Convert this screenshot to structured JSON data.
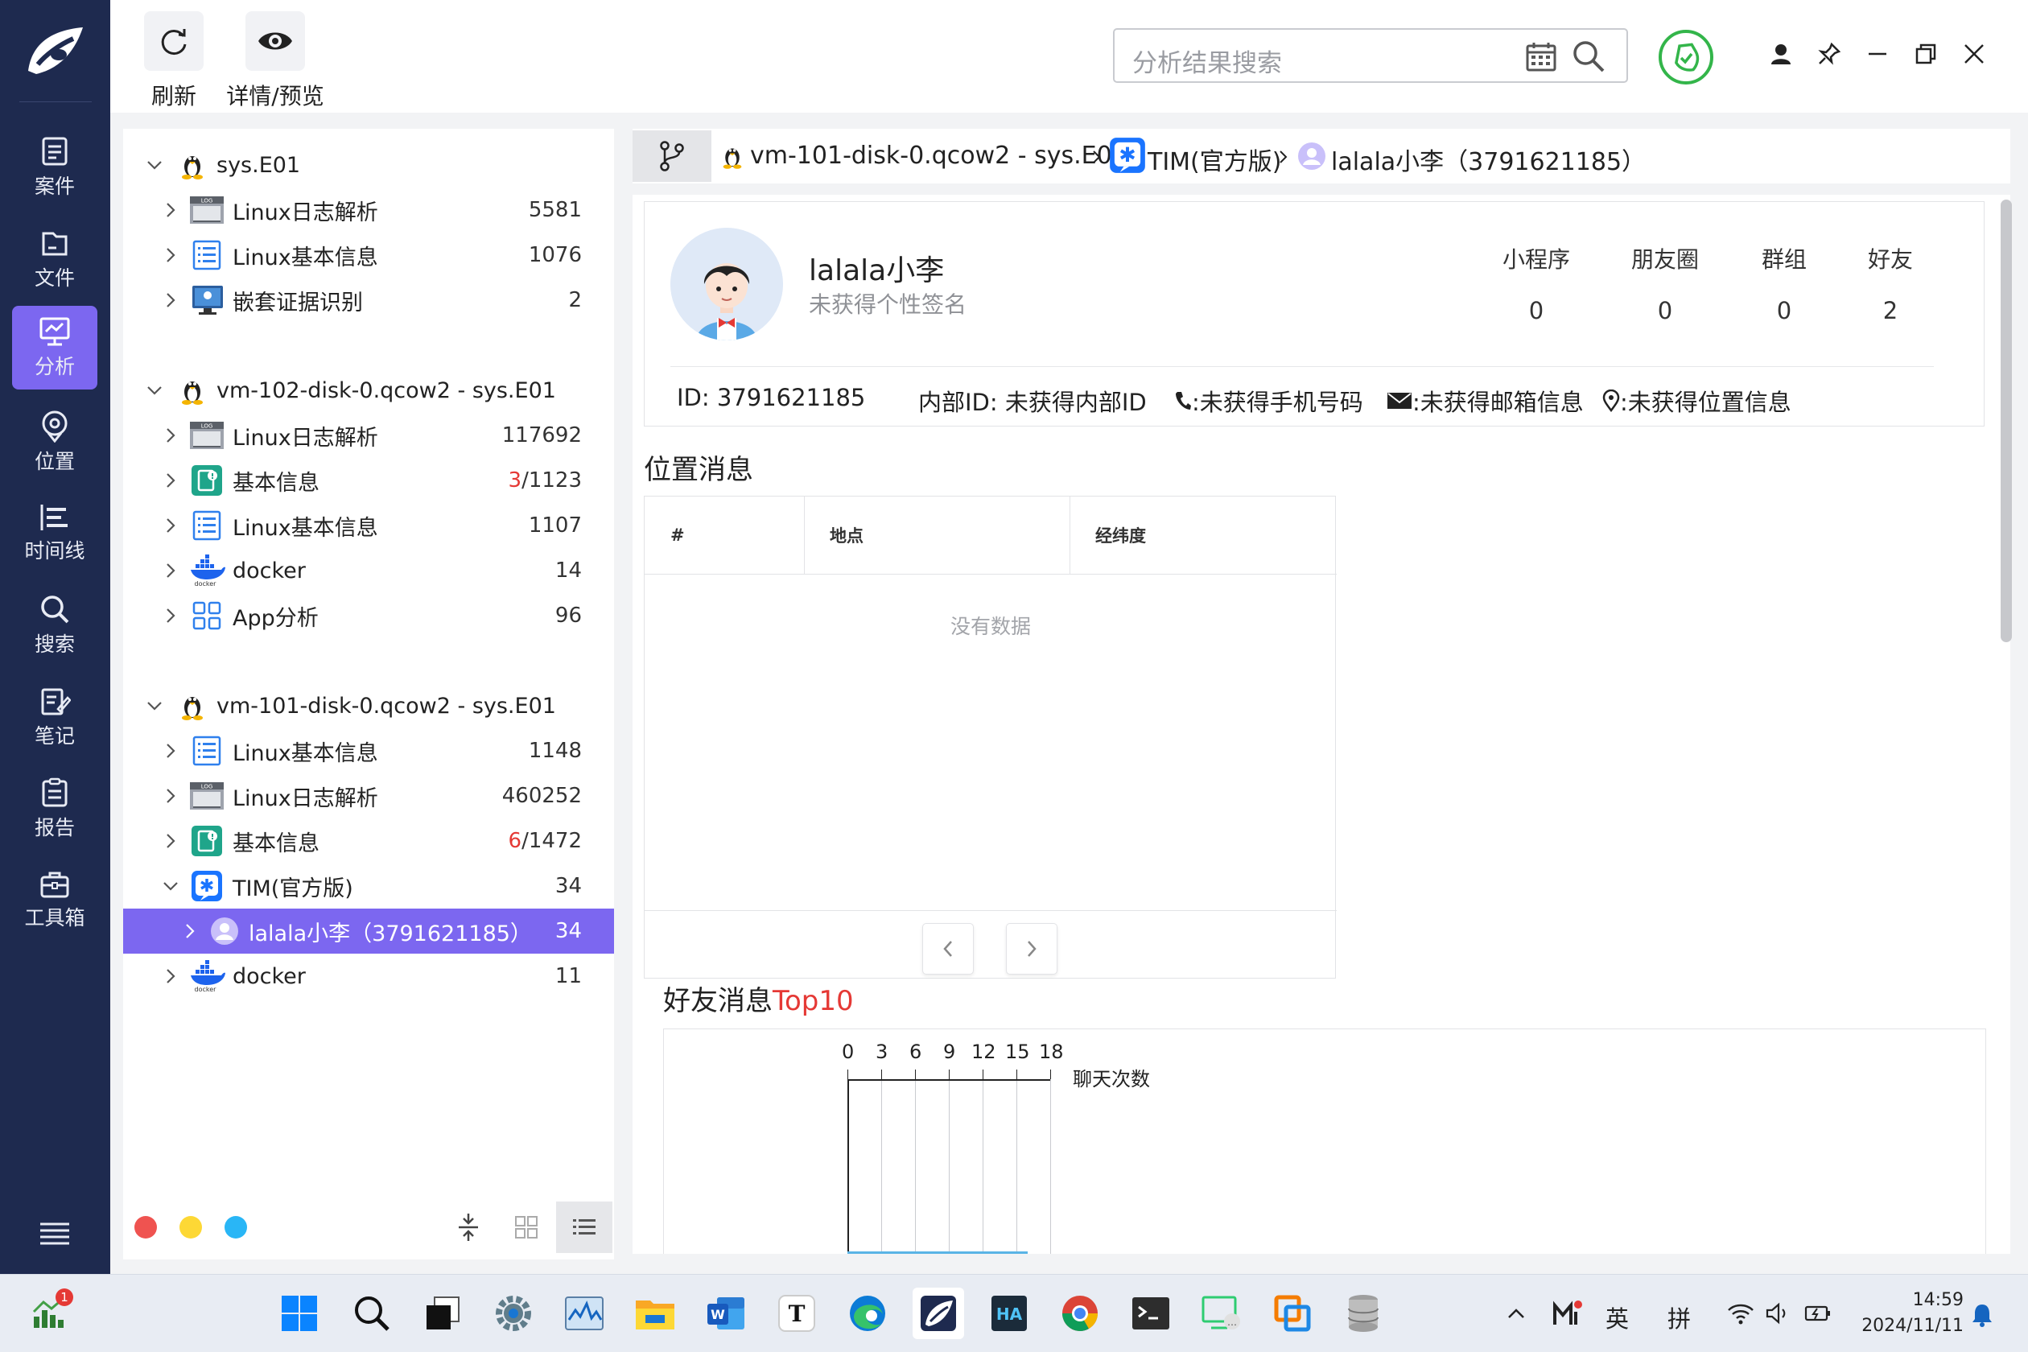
{
  "nav": {
    "items": [
      {
        "label": "案件",
        "icon": "case-icon"
      },
      {
        "label": "文件",
        "icon": "file-icon"
      },
      {
        "label": "分析",
        "icon": "analysis-icon",
        "active": true
      },
      {
        "label": "位置",
        "icon": "location-icon"
      },
      {
        "label": "时间线",
        "icon": "timeline-icon"
      },
      {
        "label": "搜索",
        "icon": "search-icon"
      },
      {
        "label": "笔记",
        "icon": "note-icon"
      },
      {
        "label": "报告",
        "icon": "report-icon"
      },
      {
        "label": "工具箱",
        "icon": "toolbox-icon"
      }
    ]
  },
  "toolbar": {
    "refresh_label": "刷新",
    "detail_label": "详情/预览",
    "search_placeholder": "分析结果搜索"
  },
  "tree": {
    "groups": [
      {
        "title": "sys.E01",
        "items": [
          {
            "label": "Linux日志解析",
            "count": "5581"
          },
          {
            "label": "Linux基本信息",
            "count": "1076"
          },
          {
            "label": "嵌套证据识别",
            "count": "2"
          }
        ]
      },
      {
        "title": "vm-102-disk-0.qcow2 - sys.E01",
        "items": [
          {
            "label": "Linux日志解析",
            "count": "117692"
          },
          {
            "label": "基本信息",
            "count_red": "3",
            "count": "/1123"
          },
          {
            "label": "Linux基本信息",
            "count": "1107"
          },
          {
            "label": "docker",
            "count": "14"
          },
          {
            "label": "App分析",
            "count": "96"
          }
        ]
      },
      {
        "title": "vm-101-disk-0.qcow2 - sys.E01",
        "items": [
          {
            "label": "Linux基本信息",
            "count": "1148"
          },
          {
            "label": "Linux日志解析",
            "count": "460252"
          },
          {
            "label": "基本信息",
            "count_red": "6",
            "count": "/1472"
          },
          {
            "label": "TIM(官方版)",
            "count": "34"
          },
          {
            "label": "lalala小李（3791621185）",
            "count": "34",
            "selected": true
          },
          {
            "label": "docker",
            "count": "11"
          }
        ]
      }
    ],
    "footer_colors": [
      "#ef5350",
      "#fdd835",
      "#29b6f6"
    ]
  },
  "breadcrumb": {
    "items": [
      "vm-101-disk-0.qcow2 - sys.E01",
      "TIM(官方版)",
      "lalala小李（3791621185）"
    ]
  },
  "profile": {
    "name": "lalala小李",
    "signature": "未获得个性签名",
    "stats": [
      {
        "label": "小程序",
        "value": "0"
      },
      {
        "label": "朋友圈",
        "value": "0"
      },
      {
        "label": "群组",
        "value": "0"
      },
      {
        "label": "好友",
        "value": "2"
      }
    ],
    "id_text": "ID: 3791621185",
    "inner_id_text": "内部ID: 未获得内部ID",
    "phone_text": ":未获得手机号码",
    "email_text": ":未获得邮箱信息",
    "location_text": ":未获得位置信息"
  },
  "location_section": {
    "title": "位置消息",
    "columns": [
      "#",
      "地点",
      "经纬度"
    ],
    "empty_text": "没有数据"
  },
  "friends_section": {
    "title_prefix": "好友消息",
    "title_highlight": "Top10"
  },
  "chart_data": {
    "type": "bar",
    "orientation": "horizontal",
    "categories": [],
    "series": [],
    "xlabel": "聊天次数",
    "xlim": [
      0,
      18
    ],
    "xticks": [
      "0",
      "3",
      "6",
      "9",
      "12",
      "15",
      "18"
    ],
    "grid": true
  },
  "taskbar": {
    "notification_badge": "1",
    "ime_lang": "英",
    "ime_mode": "拼",
    "time": "14:59",
    "date": "2024/11/11"
  },
  "colors": {
    "accent": "#7c67f0",
    "nav_bg": "#1e2a4f",
    "red": "#e53935",
    "shield": "#33b54a"
  }
}
